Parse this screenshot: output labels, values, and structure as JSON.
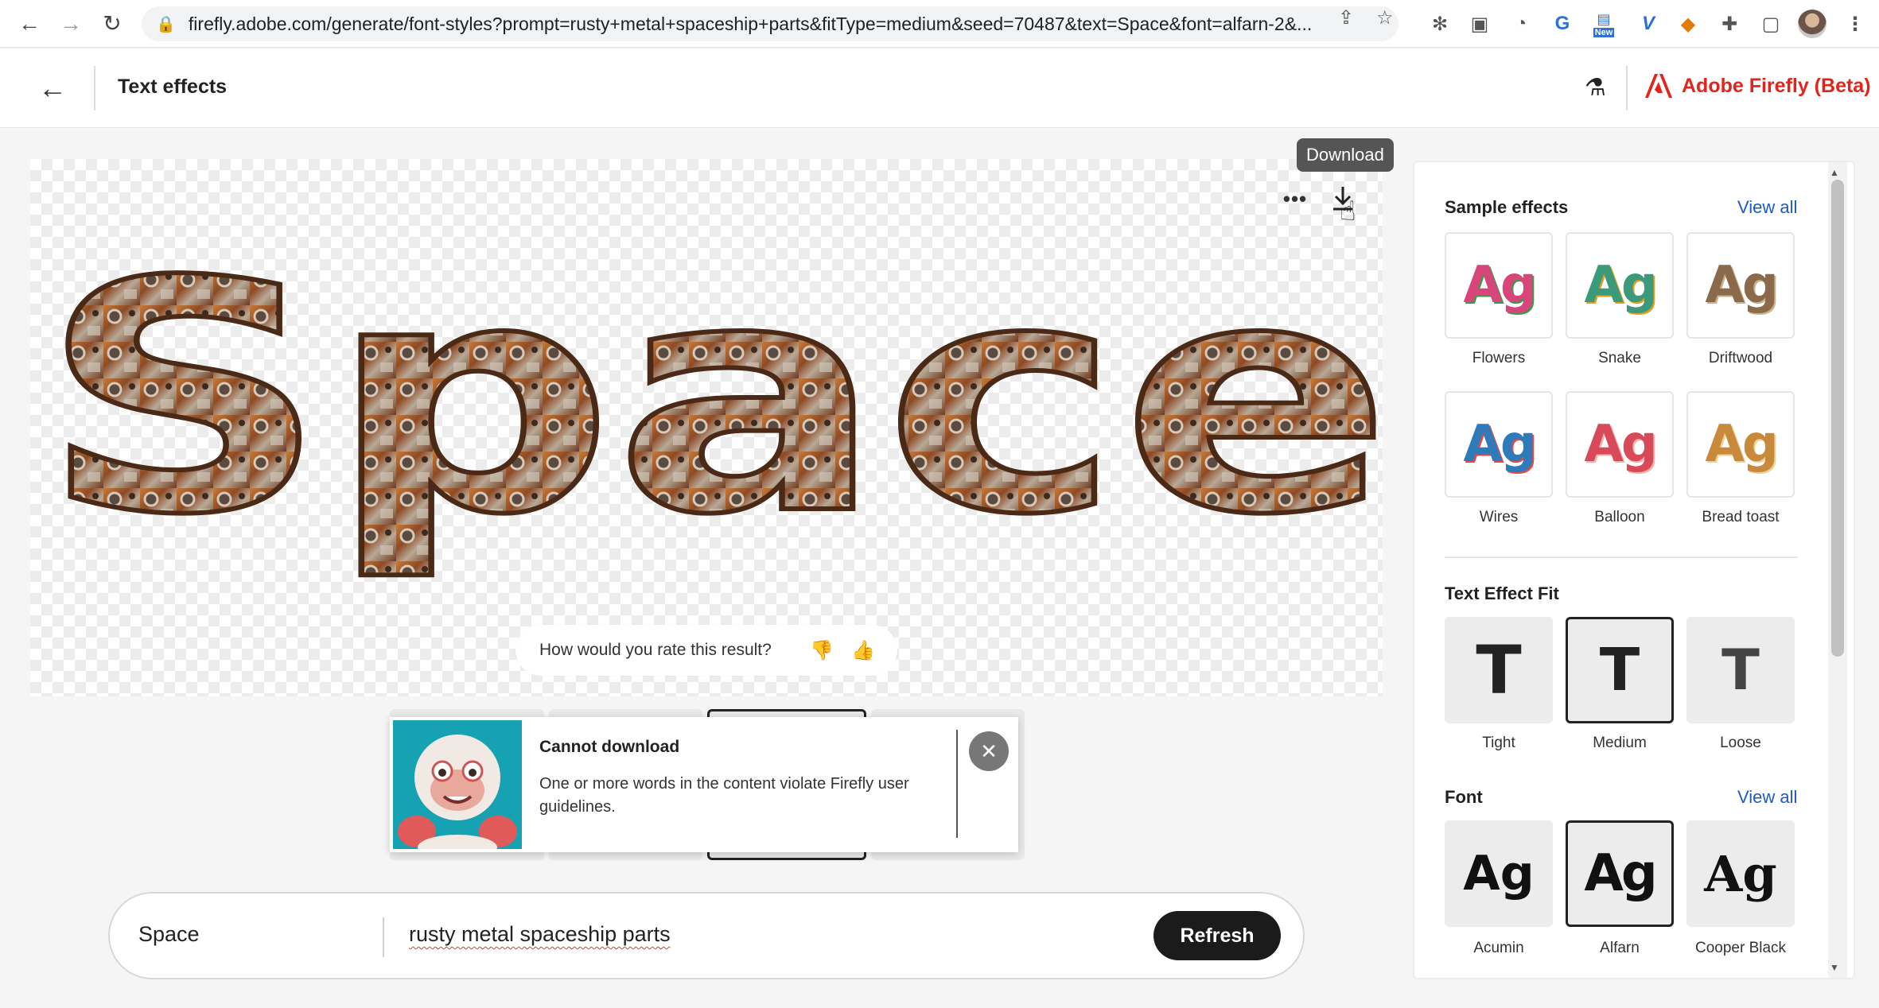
{
  "browser": {
    "url": "firefly.adobe.com/generate/font-styles?prompt=rusty+metal+spaceship+parts&fitType=medium&seed=70487&text=Space&font=alfarn-2&...",
    "extension_new_badge": "New"
  },
  "header": {
    "title": "Text effects",
    "brand": "Adobe Firefly (Beta)"
  },
  "canvas": {
    "rendered_text": "Space",
    "download_tooltip": "Download",
    "more_label": "•••"
  },
  "feedback": {
    "question": "How would you rate this result?"
  },
  "toast": {
    "title": "Cannot download",
    "message": "One or more words in the content violate Firefly user guidelines."
  },
  "prompt": {
    "text": "Space",
    "description": "rusty metal spaceship parts",
    "refresh_label": "Refresh"
  },
  "panel": {
    "sample_effects": {
      "title": "Sample effects",
      "view_all": "View all",
      "sample_glyph": "Ag",
      "items": [
        {
          "label": "Flowers",
          "color": "#d8457a"
        },
        {
          "label": "Snake",
          "color": "#3a9a7a"
        },
        {
          "label": "Driftwood",
          "color": "#8a6a4a"
        },
        {
          "label": "Wires",
          "color": "#2f7ab8"
        },
        {
          "label": "Balloon",
          "color": "#d84a5a"
        },
        {
          "label": "Bread toast",
          "color": "#c8893a"
        }
      ]
    },
    "fit": {
      "title": "Text Effect Fit",
      "glyph": "T",
      "items": [
        {
          "label": "Tight",
          "selected": false
        },
        {
          "label": "Medium",
          "selected": true
        },
        {
          "label": "Loose",
          "selected": false
        }
      ]
    },
    "font": {
      "title": "Font",
      "view_all": "View all",
      "glyph": "Ag",
      "items": [
        {
          "label": "Acumin",
          "selected": false
        },
        {
          "label": "Alfarn",
          "selected": true
        },
        {
          "label": "Cooper Black",
          "selected": false
        }
      ]
    }
  },
  "colors": {
    "brand_red": "#e1251b",
    "link_blue": "#1d5bbf",
    "rust": "#a5552a"
  }
}
